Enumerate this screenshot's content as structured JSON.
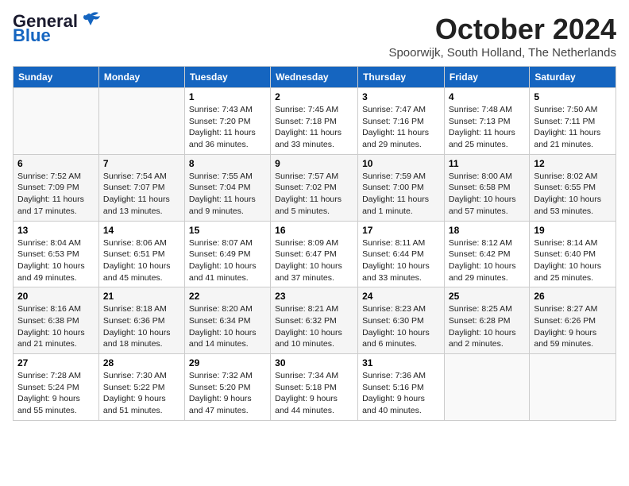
{
  "header": {
    "logo_line1": "General",
    "logo_line2": "Blue",
    "month": "October 2024",
    "location": "Spoorwijk, South Holland, The Netherlands"
  },
  "days_of_week": [
    "Sunday",
    "Monday",
    "Tuesday",
    "Wednesday",
    "Thursday",
    "Friday",
    "Saturday"
  ],
  "weeks": [
    [
      {
        "day": "",
        "content": ""
      },
      {
        "day": "",
        "content": ""
      },
      {
        "day": "1",
        "content": "Sunrise: 7:43 AM\nSunset: 7:20 PM\nDaylight: 11 hours and 36 minutes."
      },
      {
        "day": "2",
        "content": "Sunrise: 7:45 AM\nSunset: 7:18 PM\nDaylight: 11 hours and 33 minutes."
      },
      {
        "day": "3",
        "content": "Sunrise: 7:47 AM\nSunset: 7:16 PM\nDaylight: 11 hours and 29 minutes."
      },
      {
        "day": "4",
        "content": "Sunrise: 7:48 AM\nSunset: 7:13 PM\nDaylight: 11 hours and 25 minutes."
      },
      {
        "day": "5",
        "content": "Sunrise: 7:50 AM\nSunset: 7:11 PM\nDaylight: 11 hours and 21 minutes."
      }
    ],
    [
      {
        "day": "6",
        "content": "Sunrise: 7:52 AM\nSunset: 7:09 PM\nDaylight: 11 hours and 17 minutes."
      },
      {
        "day": "7",
        "content": "Sunrise: 7:54 AM\nSunset: 7:07 PM\nDaylight: 11 hours and 13 minutes."
      },
      {
        "day": "8",
        "content": "Sunrise: 7:55 AM\nSunset: 7:04 PM\nDaylight: 11 hours and 9 minutes."
      },
      {
        "day": "9",
        "content": "Sunrise: 7:57 AM\nSunset: 7:02 PM\nDaylight: 11 hours and 5 minutes."
      },
      {
        "day": "10",
        "content": "Sunrise: 7:59 AM\nSunset: 7:00 PM\nDaylight: 11 hours and 1 minute."
      },
      {
        "day": "11",
        "content": "Sunrise: 8:00 AM\nSunset: 6:58 PM\nDaylight: 10 hours and 57 minutes."
      },
      {
        "day": "12",
        "content": "Sunrise: 8:02 AM\nSunset: 6:55 PM\nDaylight: 10 hours and 53 minutes."
      }
    ],
    [
      {
        "day": "13",
        "content": "Sunrise: 8:04 AM\nSunset: 6:53 PM\nDaylight: 10 hours and 49 minutes."
      },
      {
        "day": "14",
        "content": "Sunrise: 8:06 AM\nSunset: 6:51 PM\nDaylight: 10 hours and 45 minutes."
      },
      {
        "day": "15",
        "content": "Sunrise: 8:07 AM\nSunset: 6:49 PM\nDaylight: 10 hours and 41 minutes."
      },
      {
        "day": "16",
        "content": "Sunrise: 8:09 AM\nSunset: 6:47 PM\nDaylight: 10 hours and 37 minutes."
      },
      {
        "day": "17",
        "content": "Sunrise: 8:11 AM\nSunset: 6:44 PM\nDaylight: 10 hours and 33 minutes."
      },
      {
        "day": "18",
        "content": "Sunrise: 8:12 AM\nSunset: 6:42 PM\nDaylight: 10 hours and 29 minutes."
      },
      {
        "day": "19",
        "content": "Sunrise: 8:14 AM\nSunset: 6:40 PM\nDaylight: 10 hours and 25 minutes."
      }
    ],
    [
      {
        "day": "20",
        "content": "Sunrise: 8:16 AM\nSunset: 6:38 PM\nDaylight: 10 hours and 21 minutes."
      },
      {
        "day": "21",
        "content": "Sunrise: 8:18 AM\nSunset: 6:36 PM\nDaylight: 10 hours and 18 minutes."
      },
      {
        "day": "22",
        "content": "Sunrise: 8:20 AM\nSunset: 6:34 PM\nDaylight: 10 hours and 14 minutes."
      },
      {
        "day": "23",
        "content": "Sunrise: 8:21 AM\nSunset: 6:32 PM\nDaylight: 10 hours and 10 minutes."
      },
      {
        "day": "24",
        "content": "Sunrise: 8:23 AM\nSunset: 6:30 PM\nDaylight: 10 hours and 6 minutes."
      },
      {
        "day": "25",
        "content": "Sunrise: 8:25 AM\nSunset: 6:28 PM\nDaylight: 10 hours and 2 minutes."
      },
      {
        "day": "26",
        "content": "Sunrise: 8:27 AM\nSunset: 6:26 PM\nDaylight: 9 hours and 59 minutes."
      }
    ],
    [
      {
        "day": "27",
        "content": "Sunrise: 7:28 AM\nSunset: 5:24 PM\nDaylight: 9 hours and 55 minutes."
      },
      {
        "day": "28",
        "content": "Sunrise: 7:30 AM\nSunset: 5:22 PM\nDaylight: 9 hours and 51 minutes."
      },
      {
        "day": "29",
        "content": "Sunrise: 7:32 AM\nSunset: 5:20 PM\nDaylight: 9 hours and 47 minutes."
      },
      {
        "day": "30",
        "content": "Sunrise: 7:34 AM\nSunset: 5:18 PM\nDaylight: 9 hours and 44 minutes."
      },
      {
        "day": "31",
        "content": "Sunrise: 7:36 AM\nSunset: 5:16 PM\nDaylight: 9 hours and 40 minutes."
      },
      {
        "day": "",
        "content": ""
      },
      {
        "day": "",
        "content": ""
      }
    ]
  ]
}
